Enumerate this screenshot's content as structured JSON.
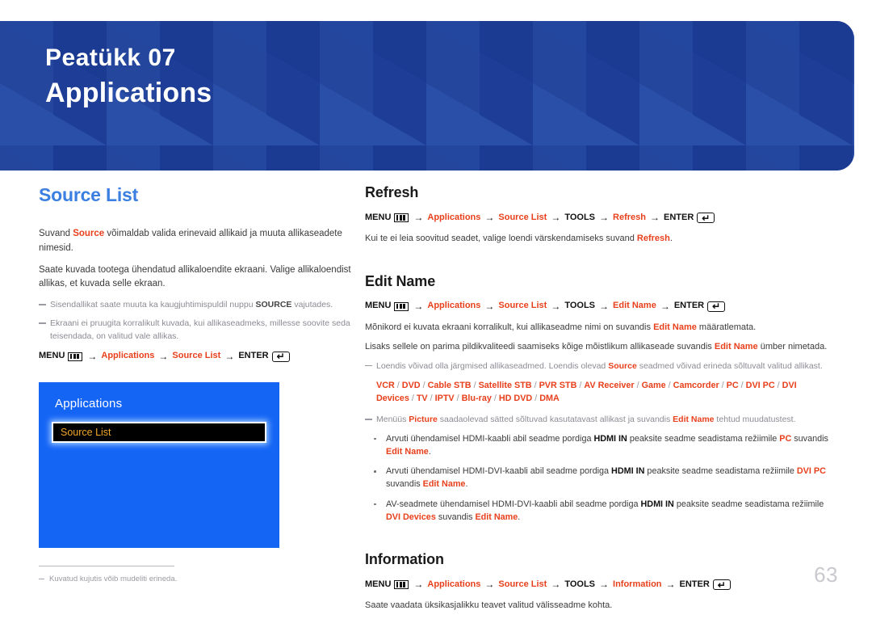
{
  "header": {
    "chapter_label": "Peatükk  07",
    "chapter_title": "Applications",
    "bg_color": "#1e3f9e"
  },
  "left": {
    "heading": "Source List",
    "paragraph_1_a": "Suvand ",
    "paragraph_1_b": "Source",
    "paragraph_1_c": " võimaldab valida erinevaid allikaid ja muuta allikaseadete nimesid.",
    "paragraph_2": "Saate kuvada tootega ühendatud allikaloendite ekraani. Valige allikaloendist allikas, et kuvada selle ekraan.",
    "note_1_a": "Sisendallikat saate muuta ka kaugjuhtimispuldil nuppu ",
    "note_1_b": "SOURCE",
    "note_1_c": " vajutades.",
    "note_2": "Ekraani ei pruugita korralikult kuvada, kui allikaseadmeks, millesse soovite seda teisendada, on valitud vale allikas.",
    "path": {
      "menu": "MENU",
      "menu_icon": "menu-bars-icon",
      "applications": "Applications",
      "source_list": "Source List",
      "enter": "ENTER",
      "enter_icon": "enter-return-icon",
      "arrow": "→"
    },
    "tv_box": {
      "title": "Applications",
      "selected_item": "Source List",
      "bg_color": "#1565f5",
      "item_text_color": "#f0a828"
    },
    "footnote": "Kuvatud kujutis võib mudeliti erineda."
  },
  "right": {
    "refresh": {
      "heading": "Refresh",
      "path": {
        "menu": "MENU",
        "applications": "Applications",
        "source_list": "Source List",
        "tools": "TOOLS",
        "item": "Refresh",
        "enter": "ENTER"
      },
      "desc_a": "Kui te ei leia soovitud seadet, valige loendi värskendamiseks suvand ",
      "desc_b": "Refresh",
      "desc_c": "."
    },
    "edit_name": {
      "heading": "Edit Name",
      "path": {
        "menu": "MENU",
        "applications": "Applications",
        "source_list": "Source List",
        "tools": "TOOLS",
        "item": "Edit Name",
        "enter": "ENTER"
      },
      "para_1_a": "Mõnikord ei kuvata ekraani korralikult, kui allikaseadme nimi on suvandis ",
      "para_1_b": "Edit Name",
      "para_1_c": " määratlemata.",
      "para_2_a": "Lisaks sellele on parima pildikvaliteedi saamiseks kõige mõistlikum allikaseade suvandis ",
      "para_2_b": "Edit Name",
      "para_2_c": " ümber nimetada.",
      "note_devices_a": "Loendis võivad olla järgmised allikaseadmed. Loendis olevad ",
      "note_devices_b": "Source",
      "note_devices_c": " seadmed võivad erineda sõltuvalt valitud allikast.",
      "devices": [
        "VCR",
        "DVD",
        "Cable STB",
        "Satellite STB",
        "PVR STB",
        "AV Receiver",
        "Game",
        "Camcorder",
        "PC",
        "DVI PC",
        "DVI Devices",
        "TV",
        "IPTV",
        "Blu-ray",
        "HD DVD",
        "DMA"
      ],
      "note_picture_a": "Menüüs ",
      "note_picture_b": "Picture",
      "note_picture_c": " saadaolevad sätted sõltuvad kasutatavast allikast ja suvandis ",
      "note_picture_d": "Edit Name",
      "note_picture_e": " tehtud muudatustest.",
      "bullets": [
        {
          "p1": "Arvuti ühendamisel HDMI-kaabli abil seadme pordiga ",
          "b1": "HDMI IN",
          "p2": " peaksite seadme seadistama režiimile ",
          "o1": "PC",
          "p3": " suvandis ",
          "o2": "Edit Name",
          "p4": "."
        },
        {
          "p1": "Arvuti ühendamisel HDMI-DVI-kaabli abil seadme pordiga ",
          "b1": "HDMI IN",
          "p2": " peaksite seadme seadistama režiimile ",
          "o1": "DVI PC",
          "p3": " suvandis ",
          "o2": "Edit Name",
          "p4": "."
        },
        {
          "p1": "AV-seadmete ühendamisel HDMI-DVI-kaabli abil seadme pordiga ",
          "b1": "HDMI IN",
          "p2": " peaksite seadme seadistama režiimile ",
          "o1": "DVI Devices",
          "p3": " suvandis ",
          "o2": "Edit Name",
          "p4": "."
        }
      ]
    },
    "information": {
      "heading": "Information",
      "path": {
        "menu": "MENU",
        "applications": "Applications",
        "source_list": "Source List",
        "tools": "TOOLS",
        "item": "Information",
        "enter": "ENTER"
      },
      "desc": "Saate vaadata üksikasjalikku teavet valitud välisseadme kohta."
    }
  },
  "page_number": "63",
  "colors": {
    "accent_orange": "#e8401c",
    "heading_blue": "#3b7fe0",
    "banner_blue": "#1e3f9e",
    "tv_blue": "#1565f5"
  }
}
